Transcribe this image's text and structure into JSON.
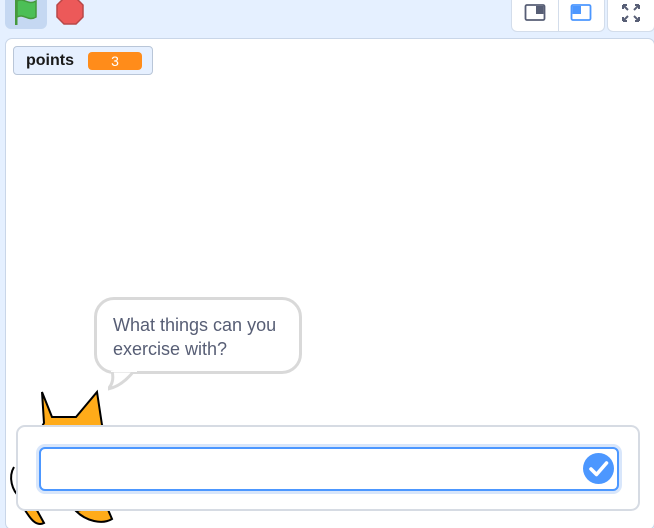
{
  "controls": {
    "green_flag": "green-flag-icon",
    "stop": "stop-sign-icon",
    "small_stage": "small-stage-layout-icon",
    "normal_stage": "normal-stage-layout-icon",
    "fullscreen": "fullscreen-icon"
  },
  "monitor": {
    "label": "points",
    "value": "3"
  },
  "speech": {
    "text": "What things can you exercise with?"
  },
  "ask": {
    "answer": "",
    "submit_icon": "check-icon"
  },
  "colors": {
    "accent": "#4c97ff",
    "monitor_value_bg": "#ff8c1a",
    "flag": "#4cbf56",
    "stop": "#ec5959"
  }
}
